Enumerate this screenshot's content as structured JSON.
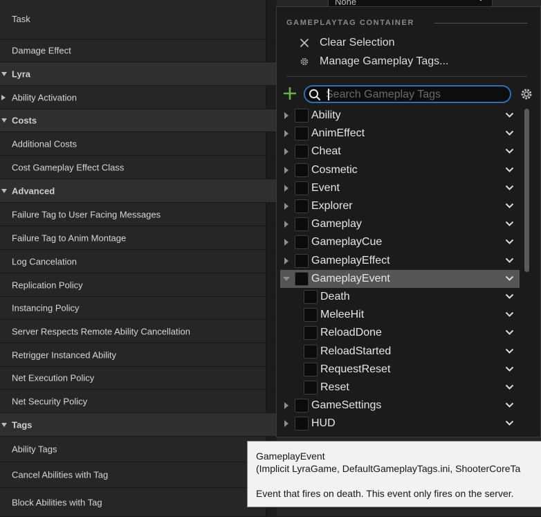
{
  "details": {
    "rows": [
      {
        "label": "Task",
        "kind": "prop"
      },
      {
        "label": "Damage Effect",
        "kind": "prop"
      },
      {
        "label": "Lyra",
        "kind": "section"
      },
      {
        "label": "Ability Activation",
        "kind": "collapsed"
      },
      {
        "label": "Costs",
        "kind": "section"
      },
      {
        "label": "Additional Costs",
        "kind": "prop"
      },
      {
        "label": "Cost Gameplay Effect Class",
        "kind": "prop"
      },
      {
        "label": "Advanced",
        "kind": "section"
      },
      {
        "label": "Failure Tag to User Facing Messages",
        "kind": "prop"
      },
      {
        "label": "Failure Tag to Anim Montage",
        "kind": "prop"
      },
      {
        "label": "Log Cancelation",
        "kind": "prop"
      },
      {
        "label": "Replication Policy",
        "kind": "prop"
      },
      {
        "label": "Instancing Policy",
        "kind": "prop"
      },
      {
        "label": "Server Respects Remote Ability Cancellation",
        "kind": "prop"
      },
      {
        "label": "Retrigger Instanced Ability",
        "kind": "prop"
      },
      {
        "label": "Net Execution Policy",
        "kind": "prop"
      },
      {
        "label": "Net Security Policy",
        "kind": "prop"
      },
      {
        "label": "Tags",
        "kind": "section"
      },
      {
        "label": "Ability Tags",
        "kind": "prop"
      },
      {
        "label": "Cancel Abilities with Tag",
        "kind": "prop"
      },
      {
        "label": "Block Abilities with Tag",
        "kind": "prop"
      }
    ],
    "task_value": "None"
  },
  "popup": {
    "header": "GAMEPLAYTAG CONTAINER",
    "clear_selection": "Clear Selection",
    "manage_tags": "Manage Gameplay Tags...",
    "search_placeholder": "Search Gameplay Tags",
    "tags": [
      {
        "name": "Ability",
        "level": 0,
        "expandable": true,
        "expanded": false,
        "selected": false
      },
      {
        "name": "AnimEffect",
        "level": 0,
        "expandable": true,
        "expanded": false,
        "selected": false
      },
      {
        "name": "Cheat",
        "level": 0,
        "expandable": true,
        "expanded": false,
        "selected": false
      },
      {
        "name": "Cosmetic",
        "level": 0,
        "expandable": true,
        "expanded": false,
        "selected": false
      },
      {
        "name": "Event",
        "level": 0,
        "expandable": true,
        "expanded": false,
        "selected": false
      },
      {
        "name": "Explorer",
        "level": 0,
        "expandable": true,
        "expanded": false,
        "selected": false
      },
      {
        "name": "Gameplay",
        "level": 0,
        "expandable": true,
        "expanded": false,
        "selected": false
      },
      {
        "name": "GameplayCue",
        "level": 0,
        "expandable": true,
        "expanded": false,
        "selected": false
      },
      {
        "name": "GameplayEffect",
        "level": 0,
        "expandable": true,
        "expanded": false,
        "selected": false
      },
      {
        "name": "GameplayEvent",
        "level": 0,
        "expandable": true,
        "expanded": true,
        "selected": true
      },
      {
        "name": "Death",
        "level": 1,
        "expandable": false,
        "expanded": false,
        "selected": false
      },
      {
        "name": "MeleeHit",
        "level": 1,
        "expandable": false,
        "expanded": false,
        "selected": false
      },
      {
        "name": "ReloadDone",
        "level": 1,
        "expandable": false,
        "expanded": false,
        "selected": false
      },
      {
        "name": "ReloadStarted",
        "level": 1,
        "expandable": false,
        "expanded": false,
        "selected": false
      },
      {
        "name": "RequestReset",
        "level": 1,
        "expandable": false,
        "expanded": false,
        "selected": false
      },
      {
        "name": "Reset",
        "level": 1,
        "expandable": false,
        "expanded": false,
        "selected": false
      },
      {
        "name": "GameSettings",
        "level": 0,
        "expandable": true,
        "expanded": false,
        "selected": false
      },
      {
        "name": "HUD",
        "level": 0,
        "expandable": true,
        "expanded": false,
        "selected": false
      }
    ]
  },
  "tooltip": {
    "title": "GameplayEvent",
    "source": "(Implicit LyraGame, DefaultGameplayTags.ini, ShooterCoreTa",
    "description": "Event that fires on death. This event only fires on the server."
  },
  "colors": {
    "accent_green": "#6ab04c",
    "search_border": "#2d6fb0",
    "selected_row": "#555555"
  }
}
